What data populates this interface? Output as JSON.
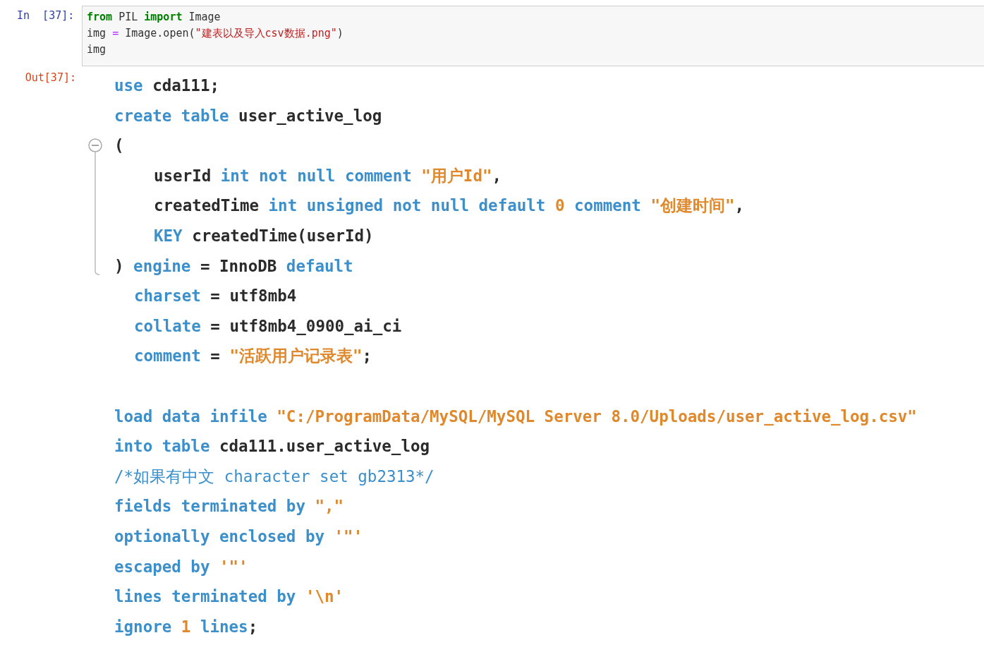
{
  "input_cell": {
    "prompt": "In  [37]:",
    "lines": [
      [
        {
          "kind": "keyword",
          "text": "from"
        },
        {
          "kind": "plain",
          "text": " PIL "
        },
        {
          "kind": "keyword",
          "text": "import"
        },
        {
          "kind": "plain",
          "text": " Image"
        }
      ],
      [
        {
          "kind": "plain",
          "text": "img "
        },
        {
          "kind": "operator",
          "text": "="
        },
        {
          "kind": "plain",
          "text": " Image.open("
        },
        {
          "kind": "string",
          "text": "\"建表以及导入csv数据.png\""
        },
        {
          "kind": "plain",
          "text": ")"
        }
      ],
      [
        {
          "kind": "plain",
          "text": "img"
        }
      ]
    ]
  },
  "output_cell": {
    "prompt": "Out[37]:",
    "sql": [
      {
        "kind": "line",
        "tokens": [
          {
            "kind": "keyword",
            "text": "use"
          },
          {
            "kind": "plain",
            "text": " cda111;"
          }
        ]
      },
      {
        "kind": "line",
        "tokens": [
          {
            "kind": "keyword",
            "text": "create table"
          },
          {
            "kind": "plain",
            "text": " user_active_log"
          }
        ]
      },
      {
        "kind": "fold",
        "expanded": true,
        "lines": [
          {
            "kind": "line",
            "tokens": [
              {
                "kind": "plain",
                "text": "("
              }
            ]
          },
          {
            "kind": "inner",
            "tokens": [
              {
                "kind": "plain",
                "text": "userId "
              },
              {
                "kind": "keyword",
                "text": "int not null comment"
              },
              {
                "kind": "string",
                "text": " \"用户Id\""
              },
              {
                "kind": "plain",
                "text": ","
              }
            ]
          },
          {
            "kind": "inner",
            "tokens": [
              {
                "kind": "plain",
                "text": "createdTime "
              },
              {
                "kind": "keyword",
                "text": "int unsigned not null default"
              },
              {
                "kind": "string",
                "text": " 0 "
              },
              {
                "kind": "keyword",
                "text": "comment"
              },
              {
                "kind": "string",
                "text": " \"创建时间\""
              },
              {
                "kind": "plain",
                "text": ","
              }
            ]
          },
          {
            "kind": "inner",
            "tokens": [
              {
                "kind": "keyword",
                "text": "KEY"
              },
              {
                "kind": "plain",
                "text": " createdTime(userId)"
              }
            ]
          },
          {
            "kind": "line",
            "tokens": [
              {
                "kind": "plain",
                "text": ") "
              },
              {
                "kind": "keyword",
                "text": "engine"
              },
              {
                "kind": "plain",
                "text": " = InnoDB "
              },
              {
                "kind": "keyword",
                "text": "default"
              }
            ]
          }
        ]
      },
      {
        "kind": "continued",
        "tokens": [
          {
            "kind": "keyword",
            "text": "charset"
          },
          {
            "kind": "plain",
            "text": " = utf8mb4"
          }
        ]
      },
      {
        "kind": "continued",
        "tokens": [
          {
            "kind": "keyword",
            "text": "collate"
          },
          {
            "kind": "plain",
            "text": " = utf8mb4_0900_ai_ci"
          }
        ]
      },
      {
        "kind": "continued",
        "tokens": [
          {
            "kind": "keyword",
            "text": "comment"
          },
          {
            "kind": "plain",
            "text": " = "
          },
          {
            "kind": "string",
            "text": "\"活跃用户记录表\""
          },
          {
            "kind": "plain",
            "text": ";"
          }
        ]
      },
      {
        "kind": "blank"
      },
      {
        "kind": "line",
        "tokens": [
          {
            "kind": "keyword",
            "text": "load data infile"
          },
          {
            "kind": "string",
            "text": " \"C:/ProgramData/MySQL/MySQL Server 8.0/Uploads/user_active_log.csv\""
          }
        ]
      },
      {
        "kind": "line",
        "tokens": [
          {
            "kind": "keyword",
            "text": "into table"
          },
          {
            "kind": "plain",
            "text": " cda111.user_active_log"
          }
        ]
      },
      {
        "kind": "line",
        "tokens": [
          {
            "kind": "comment",
            "text": "/*如果有中文 character set gb2313*/"
          }
        ]
      },
      {
        "kind": "line",
        "tokens": [
          {
            "kind": "keyword",
            "text": "fields terminated by"
          },
          {
            "kind": "string",
            "text": " \",\""
          }
        ]
      },
      {
        "kind": "line",
        "tokens": [
          {
            "kind": "keyword",
            "text": "optionally enclosed by"
          },
          {
            "kind": "string",
            "text": " '\"'"
          }
        ]
      },
      {
        "kind": "line",
        "tokens": [
          {
            "kind": "keyword",
            "text": "escaped by"
          },
          {
            "kind": "string",
            "text": " '\"'"
          }
        ]
      },
      {
        "kind": "line",
        "tokens": [
          {
            "kind": "keyword",
            "text": "lines terminated by"
          },
          {
            "kind": "string",
            "text": " '\\n'"
          }
        ]
      },
      {
        "kind": "line",
        "tokens": [
          {
            "kind": "keyword",
            "text": "ignore"
          },
          {
            "kind": "string",
            "text": " 1 "
          },
          {
            "kind": "keyword",
            "text": "lines"
          },
          {
            "kind": "plain",
            "text": ";"
          }
        ]
      }
    ]
  }
}
